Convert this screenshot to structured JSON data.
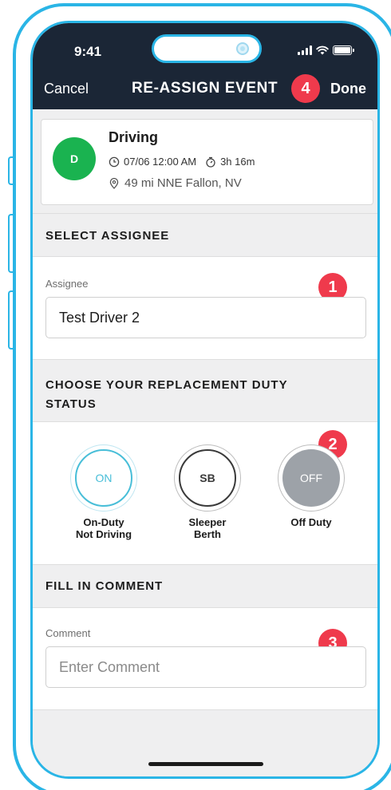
{
  "status_bar": {
    "time": "9:41"
  },
  "nav": {
    "cancel_label": "Cancel",
    "title": "RE-ASSIGN EVENT",
    "done_label": "Done",
    "done_badge": "4"
  },
  "event": {
    "avatar_initial": "D",
    "title": "Driving",
    "datetime": "07/06 12:00 AM",
    "duration": "3h 16m",
    "location": "49 mi NNE Fallon, NV"
  },
  "assignee_section": {
    "header": "SELECT ASSIGNEE",
    "field_label": "Assignee",
    "value": "Test Driver 2",
    "badge": "1"
  },
  "duty_section": {
    "header_line1": "CHOOSE YOUR REPLACEMENT DUTY",
    "header_line2": "STATUS",
    "badge": "2",
    "options": [
      {
        "code": "ON",
        "label_line1": "On-Duty",
        "label_line2": "Not Driving"
      },
      {
        "code": "SB",
        "label_line1": "Sleeper",
        "label_line2": "Berth"
      },
      {
        "code": "OFF",
        "label_line1": "Off Duty",
        "label_line2": ""
      }
    ]
  },
  "comment_section": {
    "header": "FILL IN COMMENT",
    "field_label": "Comment",
    "placeholder": "Enter Comment",
    "badge": "3"
  },
  "colors": {
    "accent_frame": "#2ab5e6",
    "navbar_bg": "#1b2636",
    "badge_red": "#ef3a4c",
    "driving_green": "#1ab350",
    "on_duty_teal": "#48bed8",
    "off_duty_gray": "#9da2a8"
  },
  "icons": {
    "datetime": "clock-icon",
    "duration": "stopwatch-icon",
    "location": "location-pin-icon"
  }
}
